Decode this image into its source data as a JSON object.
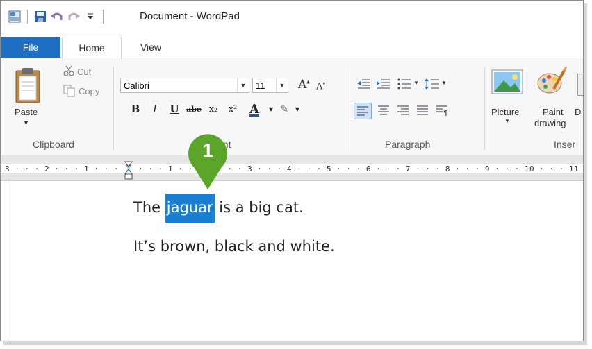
{
  "window": {
    "title": "Document - WordPad"
  },
  "quick_access": {
    "icons": [
      "app-icon",
      "save-icon",
      "undo-icon",
      "redo-icon",
      "customize-icon"
    ]
  },
  "tabs": [
    {
      "label": "File"
    },
    {
      "label": "Home"
    },
    {
      "label": "View"
    }
  ],
  "clipboard": {
    "paste_label": "Paste",
    "cut_label": "Cut",
    "copy_label": "Copy",
    "group_label": "Clipboard"
  },
  "font": {
    "family": "Calibri",
    "size": "11",
    "group_label_partial": "ont",
    "format_buttons": [
      "B",
      "I",
      "U",
      "abe",
      "x₂",
      "x²",
      "A",
      "✎"
    ]
  },
  "paragraph": {
    "group_label": "Paragraph"
  },
  "insert": {
    "picture_label": "Picture",
    "paint_label_line1": "Paint",
    "paint_label_line2": "drawing",
    "cut_off_label": "D",
    "group_label_partial": "Inser"
  },
  "ruler": {
    "text": "3 · · · 2 · · · 1 · · · ⌛ · · · 1 · · · 2 · · · 3 · · · 4 · · · 5 · · · 6 · · · 7 · · · 8 · · · 9 · · · 10 · · · 11 ·"
  },
  "callout": {
    "number": "1",
    "color": "#5aa52a"
  },
  "document": {
    "line1_prefix": "The ",
    "line1_selected": "jaguar",
    "line1_suffix": " is a big cat.",
    "line2": "It’s brown, black and white.",
    "selection_color": "#1a7fd1"
  }
}
